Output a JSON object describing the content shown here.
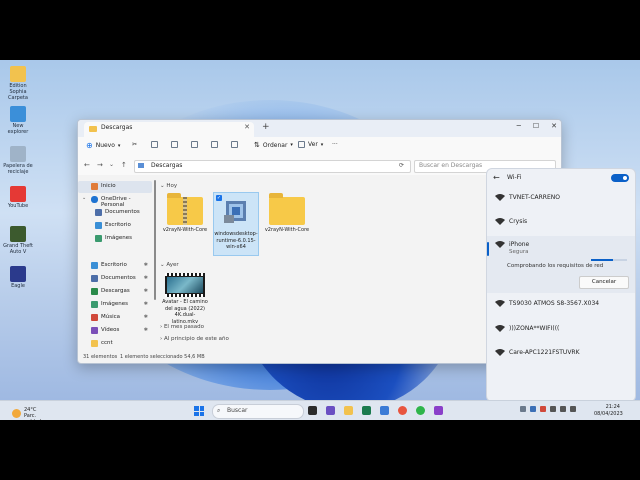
{
  "desktop": {
    "icons": [
      {
        "label": "Edition Sophia Carpeta",
        "color": "#f2c24e"
      },
      {
        "label": "New explorer",
        "color": "#3b8fd9"
      },
      {
        "label": "Papelera de reciclaje",
        "color": "#9fb3c8"
      },
      {
        "label": "YouTube",
        "color": "#e53935"
      },
      {
        "label": "Grand Theft Auto V",
        "color": "#3c5a2e"
      },
      {
        "label": "Eagle",
        "color": "#2b3a8c"
      }
    ]
  },
  "explorer": {
    "tab_title": "Descargas",
    "toolbar": {
      "new_label": "Nuevo",
      "sort_label": "Ordenar",
      "view_label": "Ver",
      "more_label": "···"
    },
    "address": "Descargas",
    "search_placeholder": "Buscar en Descargas",
    "nav": [
      {
        "label": "Inicio",
        "color": "#e07b39",
        "pinned": false
      },
      {
        "label": "OneDrive - Personal",
        "color": "#1e73d2",
        "pinned": false
      },
      {
        "label": "Documentos",
        "color": "#4d6ea8",
        "pinned": false
      },
      {
        "label": "Escritorio",
        "color": "#3a8fd6",
        "pinned": false
      },
      {
        "label": "Imágenes",
        "color": "#3a9a6e",
        "pinned": false
      },
      {
        "label": "Escritorio",
        "color": "#3a8fd6",
        "pinned": true
      },
      {
        "label": "Documentos",
        "color": "#4d6ea8",
        "pinned": true
      },
      {
        "label": "Descargas",
        "color": "#2a8a4a",
        "pinned": true
      },
      {
        "label": "Imágenes",
        "color": "#3a9a6e",
        "pinned": true
      },
      {
        "label": "Música",
        "color": "#d0483a",
        "pinned": true
      },
      {
        "label": "Vídeos",
        "color": "#7b4fb8",
        "pinned": true
      },
      {
        "label": "ccnt",
        "color": "#f2c24e",
        "pinned": false
      }
    ],
    "groups": {
      "today": "Hoy",
      "yesterday": "Ayer",
      "last_month": "El mes pasado",
      "start_of_year": "Al principio de este año"
    },
    "files_today": [
      {
        "name": "v2rayN-With-Core",
        "kind": "zip"
      },
      {
        "name": "windowsdesktop-runtime-6.0.15-win-x64",
        "kind": "installer"
      },
      {
        "name": "v2rayN-With-Core",
        "kind": "folder"
      }
    ],
    "files_yesterday": [
      {
        "name": "Avatar - El camino del agua (2022) 4K.dual-latino.mkv",
        "kind": "video"
      }
    ],
    "status": {
      "count": "31 elementos",
      "selection": "1 elemento seleccionado 54,6 MB"
    }
  },
  "wifi": {
    "title": "Wi-Fi",
    "networks": [
      {
        "name": "TVNET-CARRENO"
      },
      {
        "name": "Crysis"
      },
      {
        "name": "iPhone",
        "status": "Segura",
        "checking": "Comprobando los requisitos de red",
        "cancel": "Cancelar",
        "progress": 0.6
      },
      {
        "name": "TS9030 ATMOS S8-3567.X034"
      },
      {
        "name": ")))ZONA**WIFI(((",
        "dim": false
      },
      {
        "name": "Care-APC1221FSTUVRK"
      }
    ]
  },
  "taskbar": {
    "temp": "24°C",
    "condition": "Parc. nublado",
    "search_label": "Buscar",
    "time": "21:24",
    "date": "08/04/2023"
  }
}
